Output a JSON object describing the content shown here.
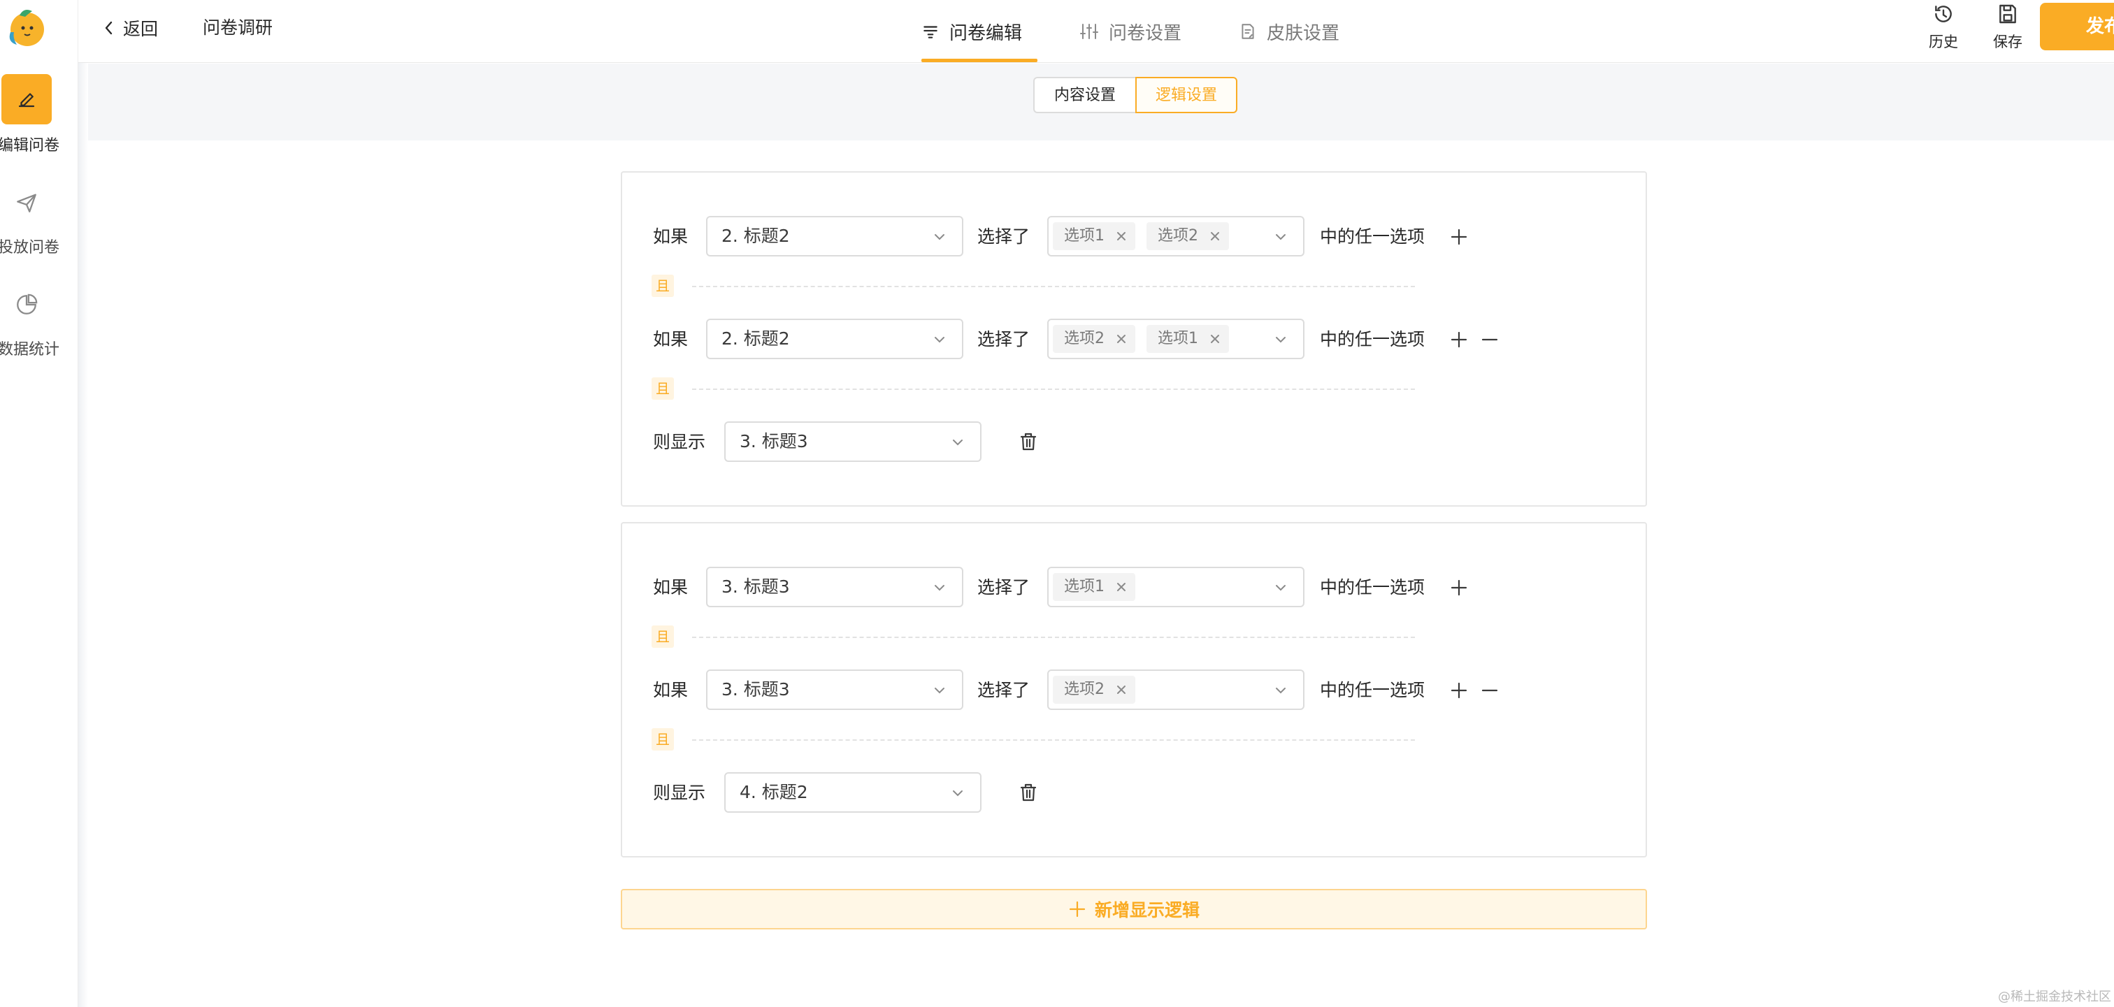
{
  "sidebar": {
    "items": [
      {
        "label": "编辑问卷",
        "icon": "pencil-icon",
        "active": true
      },
      {
        "label": "投放问卷",
        "icon": "send-icon",
        "active": false
      },
      {
        "label": "数据统计",
        "icon": "pie-chart-icon",
        "active": false
      }
    ]
  },
  "header": {
    "back_label": "返回",
    "survey_title": "问卷调研",
    "tabs": [
      {
        "label": "问卷编辑",
        "icon": "list-icon",
        "active": true
      },
      {
        "label": "问卷设置",
        "icon": "sliders-icon",
        "active": false
      },
      {
        "label": "皮肤设置",
        "icon": "skin-icon",
        "active": false
      }
    ],
    "actions": [
      {
        "label": "历史",
        "icon": "history-icon"
      },
      {
        "label": "保存",
        "icon": "save-icon"
      }
    ],
    "publish_label": "发布"
  },
  "subtabs": {
    "content": "内容设置",
    "logic": "逻辑设置",
    "active": "逻辑设置"
  },
  "logic_rules": [
    {
      "conditions": [
        {
          "if_label": "如果",
          "question": "2. 标题2",
          "chose_label": "选择了",
          "options": [
            "选项1",
            "选项2"
          ],
          "suffix": "中的任一选项"
        },
        {
          "if_label": "如果",
          "question": "2. 标题2",
          "chose_label": "选择了",
          "options": [
            "选项2",
            "选项1"
          ],
          "suffix": "中的任一选项"
        }
      ],
      "and_label": "且",
      "then_label": "则显示",
      "target": "3. 标题3"
    },
    {
      "conditions": [
        {
          "if_label": "如果",
          "question": "3. 标题3",
          "chose_label": "选择了",
          "options": [
            "选项1"
          ],
          "suffix": "中的任一选项"
        },
        {
          "if_label": "如果",
          "question": "3. 标题3",
          "chose_label": "选择了",
          "options": [
            "选项2"
          ],
          "suffix": "中的任一选项"
        }
      ],
      "and_label": "且",
      "then_label": "则显示",
      "target": "4. 标题2"
    }
  ],
  "add_logic_label": "新增显示逻辑",
  "watermark": "@稀土掘金技术社区",
  "colors": {
    "accent": "#faac25",
    "accent_light": "#fff7e6",
    "text": "#292929",
    "muted": "#7a7a7a",
    "border": "#dcdcdc"
  }
}
